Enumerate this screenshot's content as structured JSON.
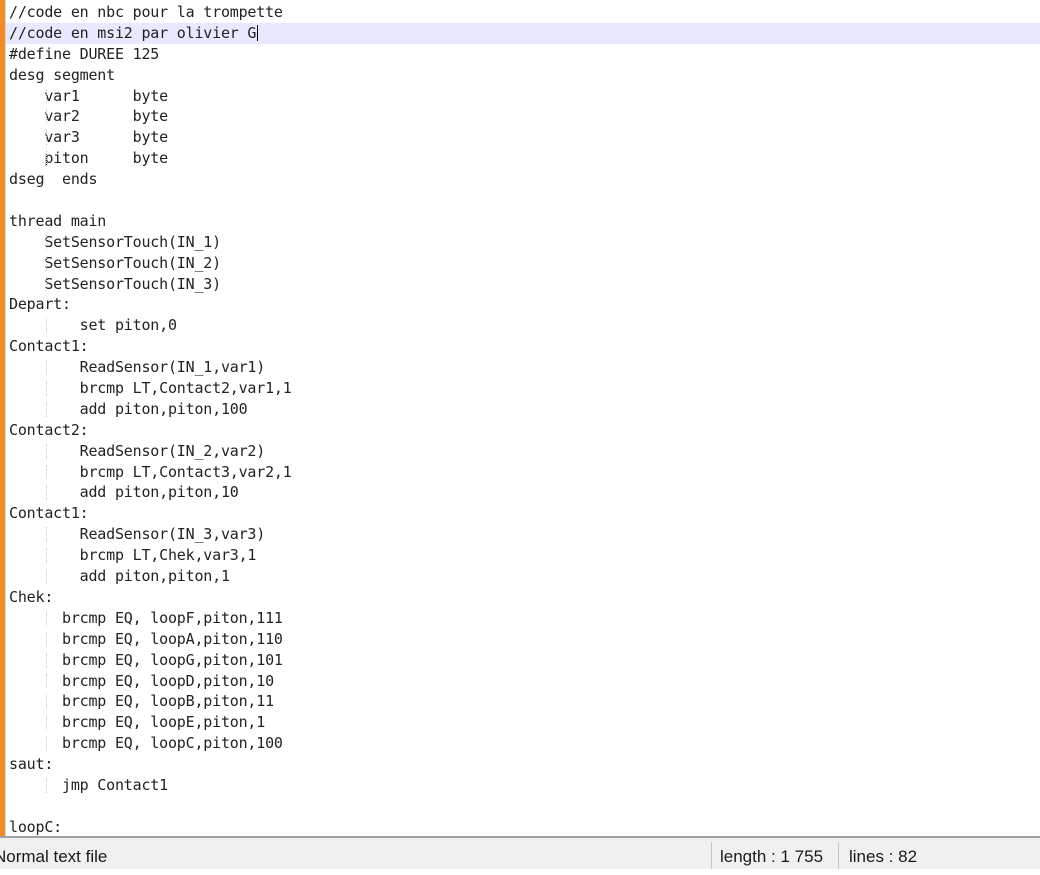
{
  "editor": {
    "current_line_index": 1,
    "lines": [
      {
        "text": "//code en nbc pour la trompette",
        "guides": 0
      },
      {
        "text": "//code en msi2 par olivier G",
        "guides": 0
      },
      {
        "text": "#define DUREE 125",
        "guides": 0
      },
      {
        "text": "desg segment",
        "guides": 0
      },
      {
        "text": "    var1      byte",
        "guides": 1
      },
      {
        "text": "    var2      byte",
        "guides": 1
      },
      {
        "text": "    var3      byte",
        "guides": 1
      },
      {
        "text": "    piton     byte",
        "guides": 1
      },
      {
        "text": "dseg  ends",
        "guides": 0
      },
      {
        "text": "",
        "guides": 0
      },
      {
        "text": "thread main",
        "guides": 0
      },
      {
        "text": "    SetSensorTouch(IN_1)",
        "guides": 1
      },
      {
        "text": "    SetSensorTouch(IN_2)",
        "guides": 1
      },
      {
        "text": "    SetSensorTouch(IN_3)",
        "guides": 1
      },
      {
        "text": "Depart:",
        "guides": 0
      },
      {
        "text": "        set piton,0",
        "guides": 1
      },
      {
        "text": "Contact1:",
        "guides": 0
      },
      {
        "text": "        ReadSensor(IN_1,var1)",
        "guides": 1
      },
      {
        "text": "        brcmp LT,Contact2,var1,1",
        "guides": 1
      },
      {
        "text": "        add piton,piton,100",
        "guides": 1
      },
      {
        "text": "Contact2:",
        "guides": 0
      },
      {
        "text": "        ReadSensor(IN_2,var2)",
        "guides": 1
      },
      {
        "text": "        brcmp LT,Contact3,var2,1",
        "guides": 1
      },
      {
        "text": "        add piton,piton,10",
        "guides": 1
      },
      {
        "text": "Contact1:",
        "guides": 0
      },
      {
        "text": "        ReadSensor(IN_3,var3)",
        "guides": 1
      },
      {
        "text": "        brcmp LT,Chek,var3,1",
        "guides": 1
      },
      {
        "text": "        add piton,piton,1",
        "guides": 1
      },
      {
        "text": "Chek:",
        "guides": 0
      },
      {
        "text": "      brcmp EQ, loopF,piton,111",
        "guides": 1
      },
      {
        "text": "      brcmp EQ, loopA,piton,110",
        "guides": 1
      },
      {
        "text": "      brcmp EQ, loopG,piton,101",
        "guides": 1
      },
      {
        "text": "      brcmp EQ, loopD,piton,10",
        "guides": 1
      },
      {
        "text": "      brcmp EQ, loopB,piton,11",
        "guides": 1
      },
      {
        "text": "      brcmp EQ, loopE,piton,1",
        "guides": 1
      },
      {
        "text": "      brcmp EQ, loopC,piton,100",
        "guides": 1
      },
      {
        "text": "saut:",
        "guides": 0
      },
      {
        "text": "      jmp Contact1",
        "guides": 1
      },
      {
        "text": "",
        "guides": 0
      },
      {
        "text": "loopC:",
        "guides": 0
      }
    ]
  },
  "statusbar": {
    "file_type": "Normal text file",
    "length": "length : 1 755",
    "lines": "lines : 82"
  },
  "colors": {
    "change_bar": "#f28c28",
    "current_line": "#e8e8ff",
    "statusbar_bg": "#f0f0f0"
  }
}
